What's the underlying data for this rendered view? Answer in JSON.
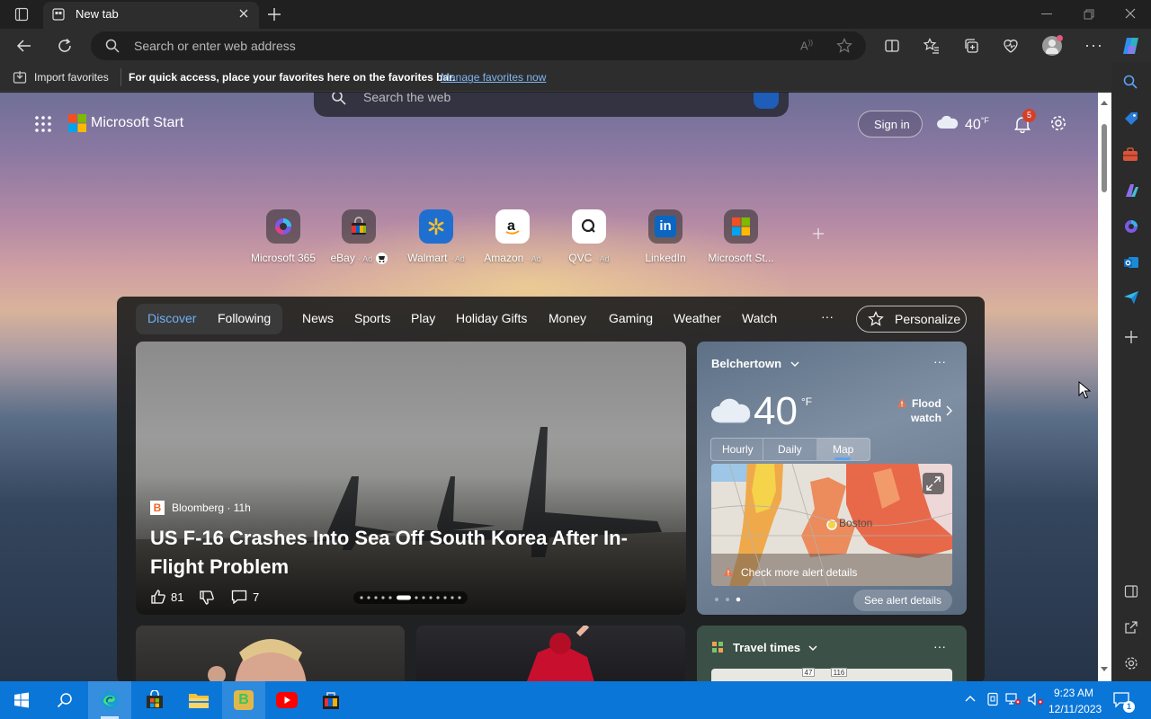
{
  "browser": {
    "tab_title": "New tab",
    "address_placeholder": "Search or enter web address",
    "favbar": {
      "import_label": "Import favorites",
      "message": "For quick access, place your favorites here on the favorites bar.",
      "manage_link": "Manage favorites now"
    }
  },
  "start": {
    "brand": "Microsoft Start",
    "search_placeholder": "Search the web",
    "sign_in": "Sign in",
    "temp": "40",
    "temp_unit": "°F",
    "notification_count": "5"
  },
  "shortcuts": [
    {
      "label": "Microsoft 365",
      "ad": ""
    },
    {
      "label": "eBay",
      "ad": "· Ad"
    },
    {
      "label": "Walmart",
      "ad": "· Ad"
    },
    {
      "label": "Amazon",
      "ad": "· Ad"
    },
    {
      "label": "QVC",
      "ad": "· Ad"
    },
    {
      "label": "LinkedIn",
      "ad": ""
    },
    {
      "label": "Microsoft St...",
      "ad": ""
    }
  ],
  "feed_nav": {
    "items": [
      "Discover",
      "Following",
      "News",
      "Sports",
      "Play",
      "Holiday Gifts",
      "Money",
      "Gaming",
      "Weather",
      "Watch"
    ],
    "more": "···",
    "personalize": "Personalize"
  },
  "hero": {
    "source": "Bloomberg · 11h",
    "headline": "US F-16 Crashes Into Sea Off South Korea After In-Flight Problem",
    "likes": "81",
    "comments": "7"
  },
  "weather_card": {
    "location": "Belchertown",
    "temp": "40",
    "unit": "°F",
    "alert_line1": "Flood",
    "alert_line2": "watch",
    "tabs": [
      "Hourly",
      "Daily",
      "Map"
    ],
    "map_city": "Boston",
    "alert_details": "Check more alert details",
    "see_alert": "See alert details",
    "more": "···"
  },
  "travel_card": {
    "title": "Travel times",
    "more": "···",
    "road1": "47",
    "road2": "116"
  },
  "taskbar": {
    "time": "9:23 AM",
    "date": "12/11/2023",
    "notif_count": "1"
  },
  "colors": {
    "accent": "#5ca3f5",
    "taskbar": "#0a76d8",
    "alert": "#e8744a"
  }
}
